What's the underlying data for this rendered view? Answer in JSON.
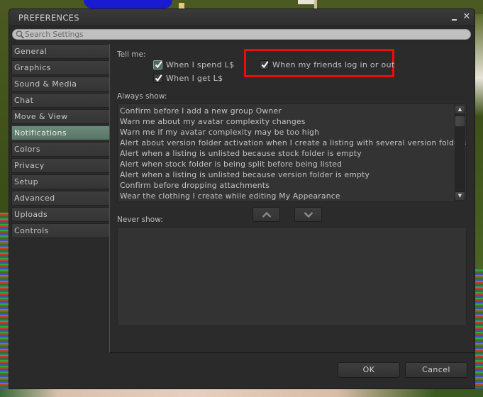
{
  "window": {
    "title": "PREFERENCES",
    "minimize_label": "minimize",
    "close_glyph": "✕"
  },
  "search": {
    "placeholder": "Search Settings",
    "value": "",
    "icon": "search-icon"
  },
  "sidebar": {
    "active": "Notifications",
    "items": [
      {
        "label": "General"
      },
      {
        "label": "Graphics"
      },
      {
        "label": "Sound & Media"
      },
      {
        "label": "Chat"
      },
      {
        "label": "Move & View"
      },
      {
        "label": "Notifications"
      },
      {
        "label": "Colors"
      },
      {
        "label": "Privacy"
      },
      {
        "label": "Setup"
      },
      {
        "label": "Advanced"
      },
      {
        "label": "Uploads"
      },
      {
        "label": "Controls"
      }
    ]
  },
  "notifications": {
    "tell_me_label": "Tell me:",
    "checks": [
      {
        "label": "When I spend L$",
        "checked": true
      },
      {
        "label": "When I get L$",
        "checked": true
      },
      {
        "label": "When my friends log in or out",
        "checked": true,
        "highlighted": true
      }
    ],
    "always_show_label": "Always show:",
    "always_show_items": [
      "Confirm before I add a new group Owner",
      "Warn me about my avatar complexity changes",
      "Warn me if my avatar complexity may be too high",
      "Alert about version folder activation when I create a listing with several version folders",
      "Alert when a listing is unlisted because stock folder is empty",
      "Alert when stock folder is being split before being listed",
      "Alert when a listing is unlisted because version folder is empty",
      "Confirm before dropping attachments",
      "Wear the clothing I create while editing My Appearance"
    ],
    "move_up_icon": "chevron-up-icon",
    "move_down_icon": "chevron-down-icon",
    "never_show_label": "Never show:",
    "never_show_items": []
  },
  "footer": {
    "ok_label": "OK",
    "cancel_label": "Cancel"
  },
  "colors": {
    "highlight_box": "#f00a0a",
    "active_tab": "#5e7a6c",
    "panel_bg": "#2a2a2a"
  }
}
